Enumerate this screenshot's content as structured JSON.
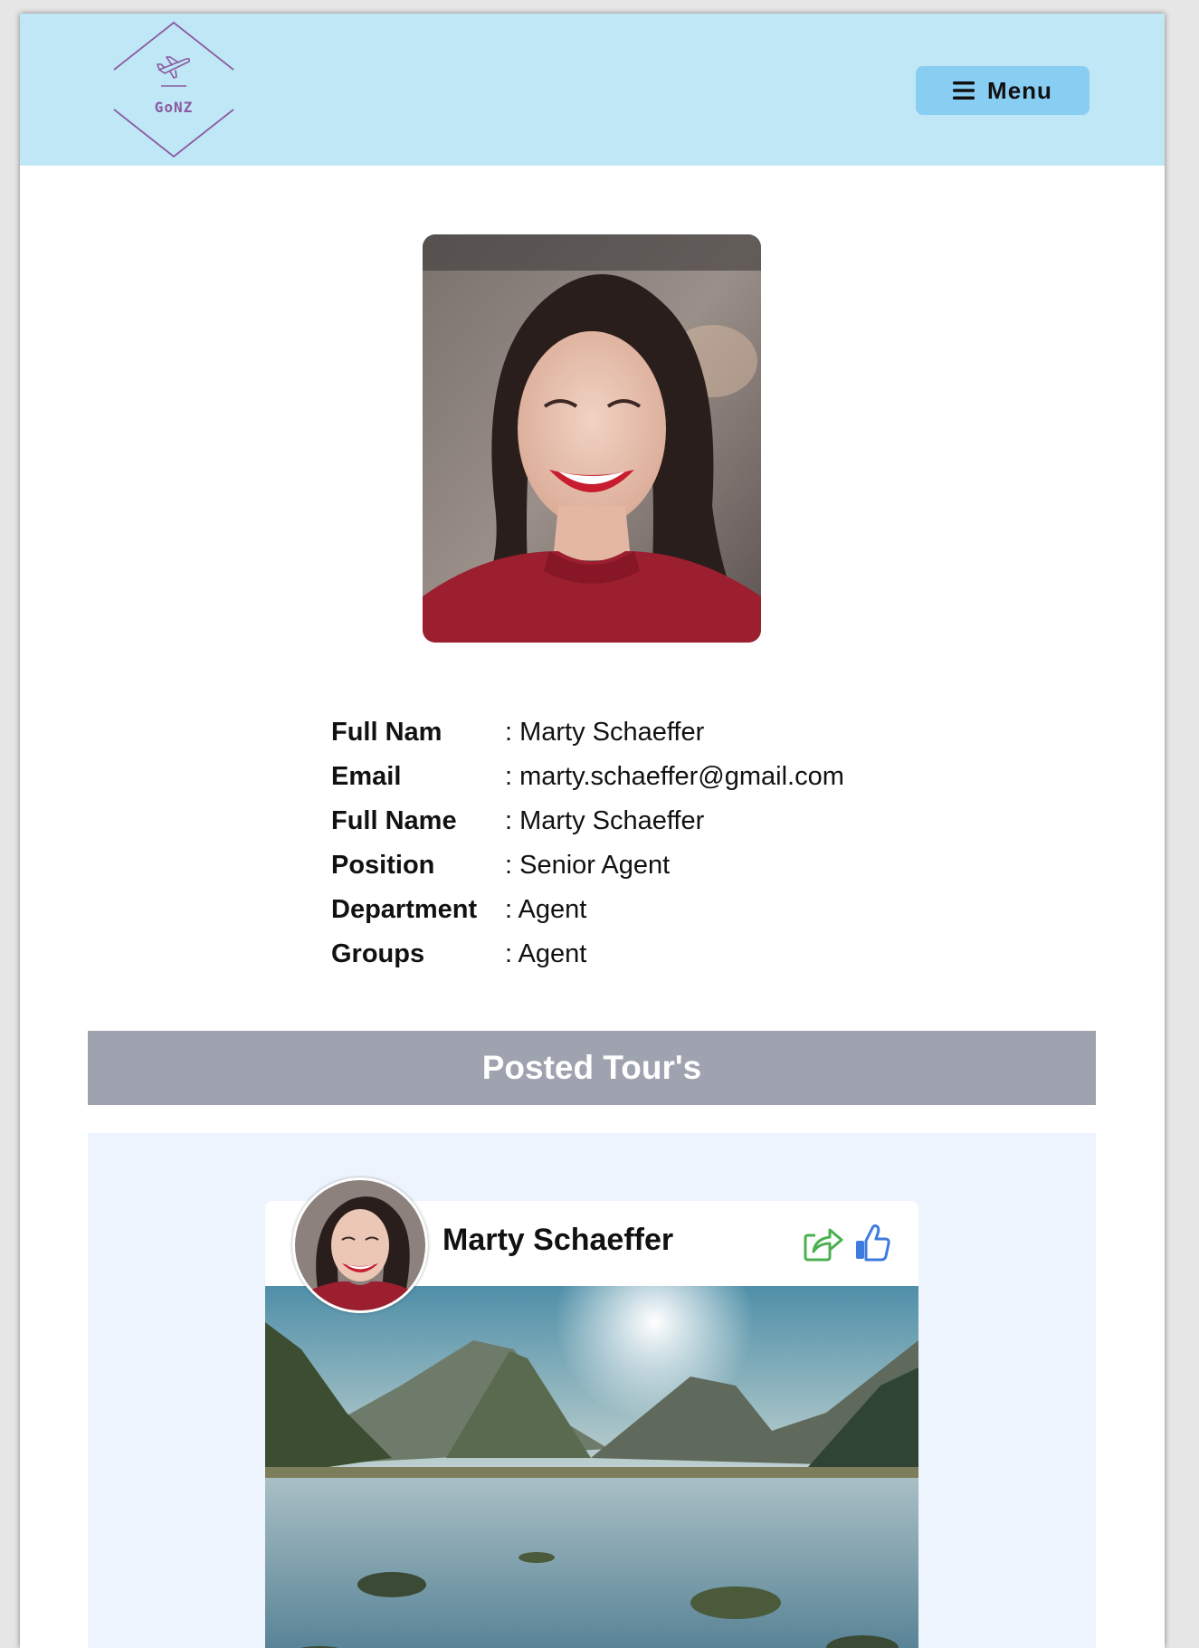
{
  "header": {
    "logo_text": "GoNZ",
    "menu_label": "Menu"
  },
  "profile": {
    "photo_alt": "profile photo",
    "fields": [
      {
        "key": "Full Nam",
        "value": ": Marty Schaeffer"
      },
      {
        "key": "Email",
        "value": ": marty.schaeffer@gmail.com"
      },
      {
        "key": "Full Name",
        "value": ": Marty Schaeffer"
      },
      {
        "key": "Position",
        "value": ": Senior Agent"
      },
      {
        "key": "Department",
        "value": ": Agent"
      },
      {
        "key": "Groups",
        "value": ": Agent"
      }
    ]
  },
  "posted_tours": {
    "title": "Posted Tour's",
    "cards": [
      {
        "author": "Marty Schaeffer"
      }
    ]
  },
  "colors": {
    "header_bg": "#bfe7f6",
    "menu_bg": "#88cdf2",
    "logo": "#8a5aa0",
    "section_bar": "#9ea3af",
    "tour_area": "#eef4fd",
    "share_icon": "#4caf50",
    "like_icon": "#3d7be0"
  },
  "icons": {
    "logo": "airplane-diamond-logo",
    "menu": "hamburger-icon",
    "share": "share-icon",
    "like": "thumbs-up-icon"
  }
}
